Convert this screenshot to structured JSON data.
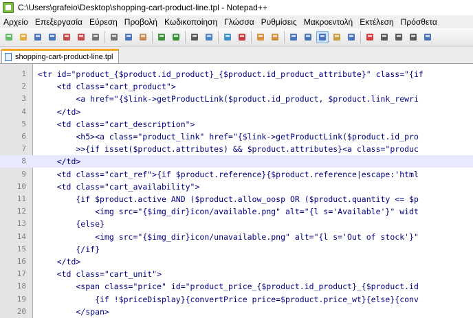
{
  "window": {
    "title": "C:\\Users\\grafeio\\Desktop\\shopping-cart-product-line.tpl - Notepad++"
  },
  "menu": [
    "Αρχείο",
    "Επεξεργασία",
    "Εύρεση",
    "Προβολή",
    "Κωδικοποίηση",
    "Γλώσσα",
    "Ρυθμίσεις",
    "Μακροεντολή",
    "Εκτέλεση",
    "Πρόσθετα"
  ],
  "toolbar": {
    "buttons": [
      {
        "icon": "new-file-icon",
        "color": "#4caf50"
      },
      {
        "icon": "open-file-icon",
        "color": "#e0a020"
      },
      {
        "icon": "save-icon",
        "color": "#3060b0"
      },
      {
        "icon": "save-all-icon",
        "color": "#3060b0"
      },
      {
        "icon": "close-icon",
        "color": "#c03030"
      },
      {
        "icon": "close-all-icon",
        "color": "#c03030"
      },
      {
        "icon": "print-icon",
        "color": "#606060"
      },
      {
        "sep": true
      },
      {
        "icon": "cut-icon",
        "color": "#606060"
      },
      {
        "icon": "copy-icon",
        "color": "#3060b0"
      },
      {
        "icon": "paste-icon",
        "color": "#c08040"
      },
      {
        "sep": true
      },
      {
        "icon": "undo-icon",
        "color": "#208020"
      },
      {
        "icon": "redo-icon",
        "color": "#208020"
      },
      {
        "sep": true
      },
      {
        "icon": "find-icon",
        "color": "#404040"
      },
      {
        "icon": "replace-icon",
        "color": "#3070c0"
      },
      {
        "sep": true
      },
      {
        "icon": "zoom-in-icon",
        "color": "#2080c0"
      },
      {
        "icon": "zoom-out-icon",
        "color": "#c02020"
      },
      {
        "sep": true
      },
      {
        "icon": "sync-vertical-icon",
        "color": "#d08020"
      },
      {
        "icon": "sync-horizontal-icon",
        "color": "#d08020"
      },
      {
        "sep": true
      },
      {
        "icon": "word-wrap-icon",
        "color": "#3060b0"
      },
      {
        "icon": "show-all-chars-icon",
        "color": "#3060b0"
      },
      {
        "icon": "indent-guide-icon",
        "color": "#3060b0",
        "active": true
      },
      {
        "icon": "user-lang-icon",
        "color": "#c09020"
      },
      {
        "icon": "doc-map-icon",
        "color": "#3060b0"
      },
      {
        "sep": true
      },
      {
        "icon": "record-macro-icon",
        "color": "#d02020"
      },
      {
        "icon": "stop-macro-icon",
        "color": "#404040"
      },
      {
        "icon": "play-macro-icon",
        "color": "#404040"
      },
      {
        "icon": "play-multiple-icon",
        "color": "#404040"
      },
      {
        "icon": "save-macro-icon",
        "color": "#3060b0"
      }
    ]
  },
  "tab": {
    "label": "shopping-cart-product-line.tpl"
  },
  "editor": {
    "current_line": 8,
    "lines": [
      {
        "n": "1",
        "text": "<tr id=\"product_{$product.id_product}_{$product.id_product_attribute}\" class=\"{if"
      },
      {
        "n": "2",
        "text": "    <td class=\"cart_product\">"
      },
      {
        "n": "3",
        "text": "        <a href=\"{$link->getProductLink($product.id_product, $product.link_rewri"
      },
      {
        "n": "4",
        "text": "    </td>"
      },
      {
        "n": "5",
        "text": "    <td class=\"cart_description\">"
      },
      {
        "n": "6",
        "text": "        <h5><a class=\"product_link\" href=\"{$link->getProductLink($product.id_pro"
      },
      {
        "n": "7",
        "text": "        >>{if isset($product.attributes) && $product.attributes}<a class=\"produc"
      },
      {
        "n": "8",
        "text": "    </td>"
      },
      {
        "n": "9",
        "text": "    <td class=\"cart_ref\">{if $product.reference}{$product.reference|escape:'html"
      },
      {
        "n": "10",
        "text": "    <td class=\"cart_availability\">"
      },
      {
        "n": "11",
        "text": "        {if $product.active AND ($product.allow_oosp OR ($product.quantity <= $p"
      },
      {
        "n": "12",
        "text": "            <img src=\"{$img_dir}icon/available.png\" alt=\"{l s='Available'}\" widt"
      },
      {
        "n": "13",
        "text": "        {else}"
      },
      {
        "n": "14",
        "text": "            <img src=\"{$img_dir}icon/unavailable.png\" alt=\"{l s='Out of stock'}\""
      },
      {
        "n": "15",
        "text": "        {/if}"
      },
      {
        "n": "16",
        "text": "    </td>"
      },
      {
        "n": "17",
        "text": "    <td class=\"cart_unit\">"
      },
      {
        "n": "18",
        "text": "        <span class=\"price\" id=\"product_price_{$product.id_product}_{$product.id"
      },
      {
        "n": "19",
        "text": "            {if !$priceDisplay}{convertPrice price=$product.price_wt}{else}{conv"
      },
      {
        "n": "20",
        "text": "        </span>"
      }
    ]
  }
}
